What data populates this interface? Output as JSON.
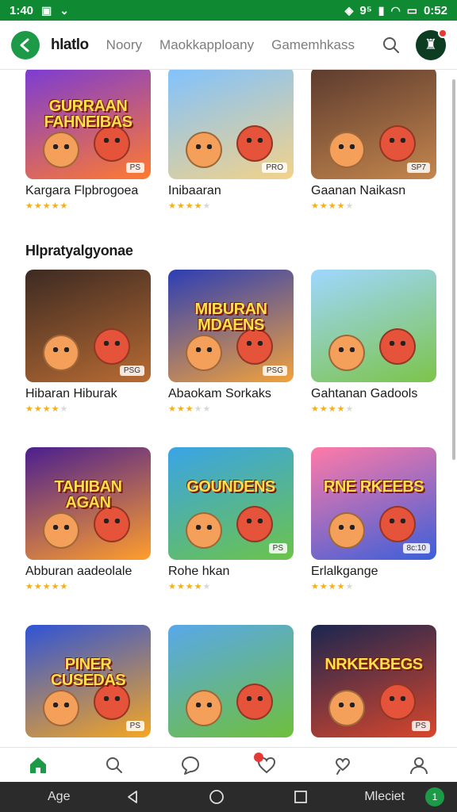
{
  "status_bar": {
    "time": "1:40",
    "battery": "0:52",
    "signal": "9⁵"
  },
  "app_bar": {
    "brand": "hlatlo",
    "nav": [
      "Noory",
      "Maokkapploany",
      "Gamemhkass"
    ]
  },
  "sections": [
    {
      "title": "",
      "items": [
        {
          "name": "Kargara Flpbrogoea",
          "thumb_text": "GURRAAN FAHNEIBAS",
          "badge": "PS",
          "rating": 5,
          "bg": "#7a3bd6",
          "bg2": "#ff7a2f"
        },
        {
          "name": "Inibaaran",
          "thumb_text": "",
          "badge": "PRO",
          "rating": 4,
          "bg": "#7fc2ff",
          "bg2": "#f3d28a"
        },
        {
          "name": "Gaanan Naikasn",
          "thumb_text": "",
          "badge": "SP7",
          "rating": 4,
          "bg": "#5b3a2e",
          "bg2": "#c4864d"
        }
      ]
    },
    {
      "title": "Hlpratyalgyonae",
      "items": [
        {
          "name": "Hibaran Hiburak",
          "thumb_text": "",
          "badge": "PSG",
          "rating": 4,
          "bg": "#3c2a22",
          "bg2": "#b86b33"
        },
        {
          "name": "Abaokam Sorkaks",
          "thumb_text": "MIBURAN MDAENS",
          "badge": "PSG",
          "rating": 3,
          "bg": "#2c3eb5",
          "bg2": "#f2a23b"
        },
        {
          "name": "Gahtanan Gadools",
          "thumb_text": "",
          "badge": "",
          "rating": 4,
          "bg": "#9fd7ff",
          "bg2": "#7cc44a"
        }
      ]
    },
    {
      "title": "",
      "items": [
        {
          "name": "Abburan aadeolale",
          "thumb_text": "TAHIBAN AGAN",
          "badge": "",
          "rating": 5,
          "bg": "#4b1f8f",
          "bg2": "#ff9e2c"
        },
        {
          "name": "Rohe hkan",
          "thumb_text": "GOUNDENS",
          "badge": "PS",
          "rating": 4,
          "bg": "#3aa4e6",
          "bg2": "#6cc34a"
        },
        {
          "name": "Erlalkgange",
          "thumb_text": "RNE RKEEBS",
          "badge": "8c:10",
          "rating": 4,
          "bg": "#ff7aa8",
          "bg2": "#3b5fd9"
        }
      ]
    },
    {
      "title": "",
      "items": [
        {
          "name": "",
          "thumb_text": "PINER CUSEDAS",
          "badge": "PS",
          "rating": 0,
          "bg": "#2f54d6",
          "bg2": "#f5a623"
        },
        {
          "name": "",
          "thumb_text": "",
          "badge": "",
          "rating": 0,
          "bg": "#58a8ea",
          "bg2": "#6fbf3c"
        },
        {
          "name": "",
          "thumb_text": "NRKEKBEGS",
          "badge": "PS",
          "rating": 0,
          "bg": "#1a2650",
          "bg2": "#d8462c"
        }
      ]
    }
  ],
  "bottom_nav": [
    {
      "icon": "home-icon",
      "active": true
    },
    {
      "icon": "search-icon",
      "active": false
    },
    {
      "icon": "chat-icon",
      "active": false
    },
    {
      "icon": "heart-icon",
      "active": false,
      "badge": true
    },
    {
      "icon": "comment-heart-icon",
      "active": false
    },
    {
      "icon": "profile-icon",
      "active": false
    }
  ],
  "system_nav": {
    "left_label": "Age",
    "right_label": "Mleciet",
    "badge": "1"
  },
  "colors": {
    "accent": "#1d9a47",
    "status_bar": "#0f8a33",
    "star": "#f2b01e"
  }
}
